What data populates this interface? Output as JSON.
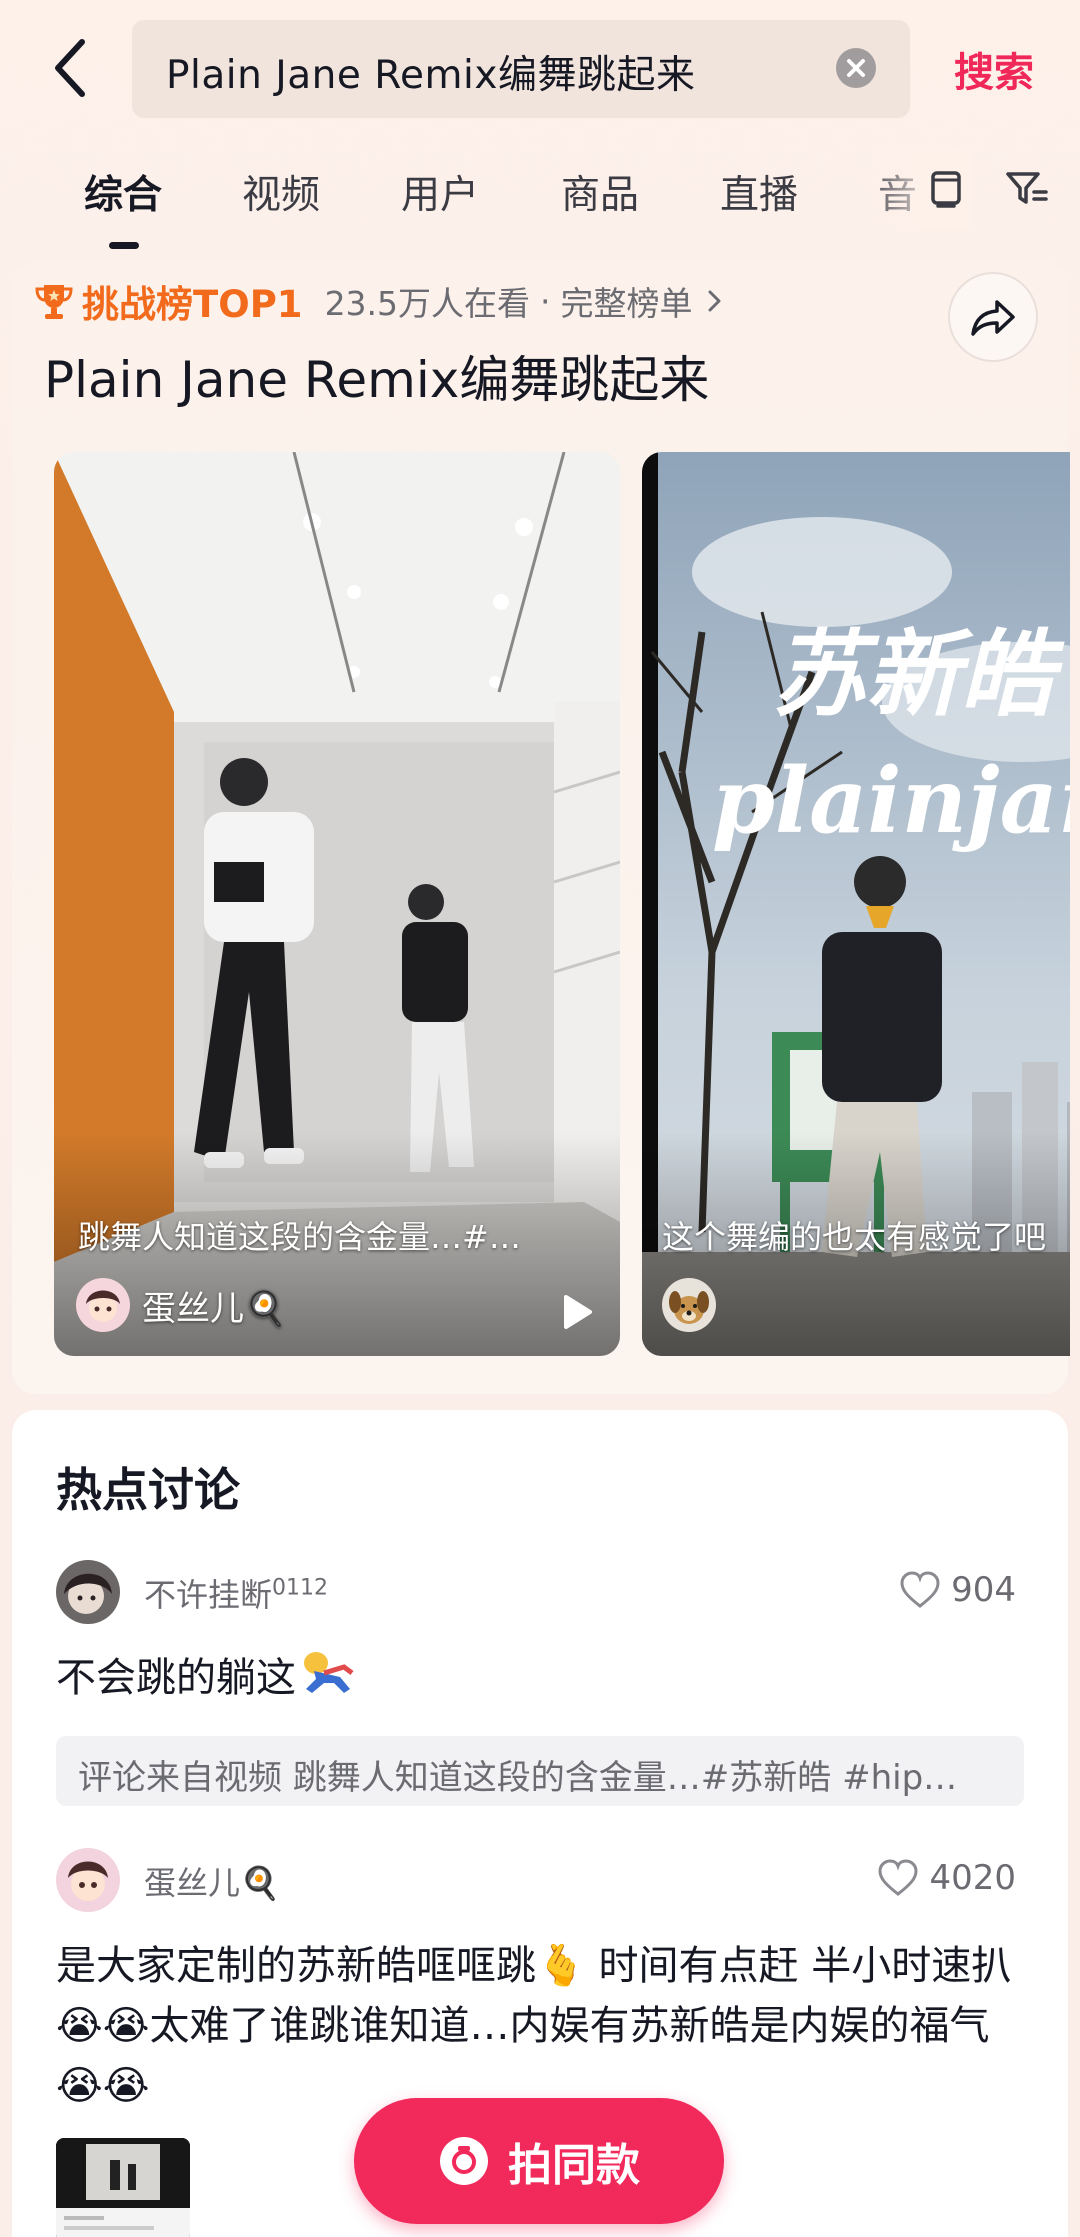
{
  "header": {
    "query": "Plain Jane Remix编舞跳起来",
    "search_label": "搜索"
  },
  "tabs": [
    {
      "label": "综合",
      "active": true
    },
    {
      "label": "视频"
    },
    {
      "label": "用户"
    },
    {
      "label": "商品"
    },
    {
      "label": "直播"
    },
    {
      "label": "音"
    }
  ],
  "challenge": {
    "badge": "挑战榜TOP1",
    "watching": "23.5万人在看",
    "separator": "·",
    "full_list": "完整榜单",
    "title": "Plain Jane Remix编舞跳起来",
    "videos": [
      {
        "caption": "跳舞人知道这段的含金量…#…",
        "author": "蛋丝儿🍳"
      },
      {
        "caption": "这个舞编的也太有感觉了吧",
        "author": "",
        "overlay_title": "苏新皓",
        "overlay_sub": "plainjane"
      }
    ]
  },
  "discussion": {
    "title": "热点讨论",
    "comments": [
      {
        "user": "不许挂断",
        "user_suffix": "0112",
        "likes": "904",
        "text": "不会跳的躺这",
        "source": "评论来自视频 跳舞人知道这段的含金量…#苏新皓 #hip…"
      },
      {
        "user": "蛋丝儿🍳",
        "likes": "4020",
        "text": "是大家定制的苏新皓哐哐跳🫰 时间有点赶 半小时速扒😭😭太难了谁跳谁知道…内娱有苏新皓是内娱的福气😭😭"
      }
    ]
  },
  "action": {
    "shoot_label": "拍同款"
  },
  "colors": {
    "accent": "#f2295b",
    "badge": "#f26b1d",
    "search": "#f0285a"
  },
  "icons": [
    "back-icon",
    "clear-icon",
    "trophy-icon",
    "chevron-right-icon",
    "share-icon",
    "play-icon",
    "heart-icon",
    "camera-icon",
    "screen-icon",
    "filter-icon"
  ]
}
